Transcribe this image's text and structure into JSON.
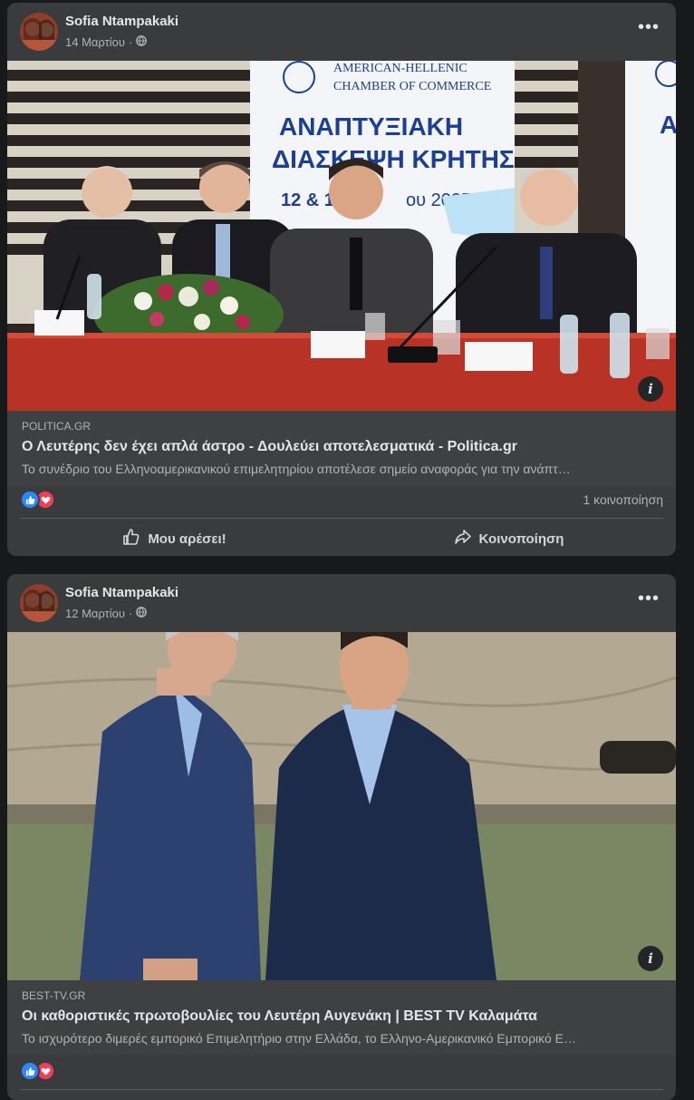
{
  "posts": [
    {
      "author": "Sofia Ntampakaki",
      "date": "14 Μαρτίου",
      "photo_banner": {
        "org_line1": "AMERICAN-HELLENIC",
        "org_line2": "CHAMBER OF COMMERCE",
        "title_line1": "ΑΝΑΠΤΥΞΙΑΚΗ",
        "title_line2": "ΔΙΑΣΚΕΨΗ ΚΡΗΤΗΣ",
        "dates_left": "12 & 1",
        "dates_right": "ου 2025",
        "right_fragment": "Α"
      },
      "link": {
        "domain": "POLITICA.GR",
        "title": "Ο Λευτέρης δεν έχει απλά άστρο - Δουλεύει αποτελεσματικά - Politica.gr",
        "description": "Το συνέδριο του Ελληνοαμερικανικού επιμελητηρίου αποτέλεσε σημείο αναφοράς για την ανάπτ…"
      },
      "shares": "1 κοινοποίηση",
      "actions": {
        "like": "Μου αρέσει!",
        "share": "Κοινοποίηση"
      }
    },
    {
      "author": "Sofia Ntampakaki",
      "date": "12 Μαρτίου",
      "link": {
        "domain": "BEST-TV.GR",
        "title": "Οι καθοριστικές πρωτοβουλίες του Λευτέρη Αυγενάκη | BEST TV Καλαμάτα",
        "description": "Το ισχυρότερο διμερές εμπορικό Επιμελητήριο στην Ελλάδα, το Ελληνο-Αμερικανικό Εμπορικό Ε…"
      }
    }
  ],
  "icons": {
    "more": "•••",
    "info": "i"
  },
  "colors": {
    "card": "#3a3b3c",
    "link_box": "#3e4042",
    "like_blue": "#2d88ff",
    "love_red": "#f33e58",
    "banner_blue": "#1c3f94"
  }
}
